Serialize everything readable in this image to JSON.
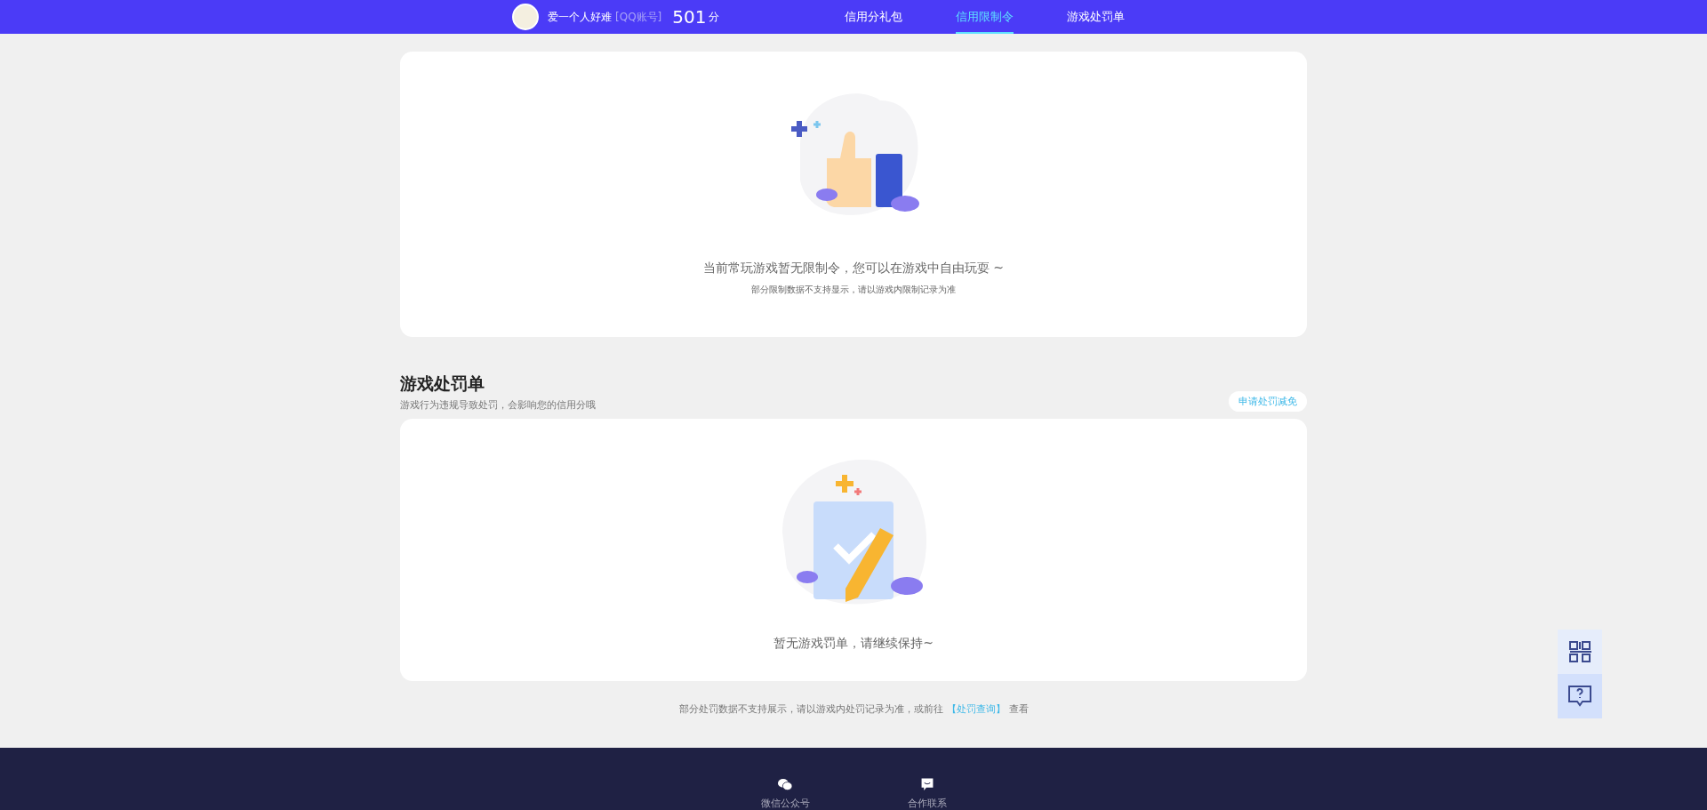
{
  "header": {
    "user": {
      "name": "爱一个人好难",
      "account_tag": "[QQ账号]",
      "score": "501",
      "score_unit": "分"
    },
    "tabs": [
      {
        "label": "信用分礼包",
        "selected": false
      },
      {
        "label": "信用限制令",
        "selected": true
      },
      {
        "label": "游戏处罚单",
        "selected": false
      }
    ]
  },
  "restriction_card": {
    "message": "当前常玩游戏暂无限制令，您可以在游戏中自由玩耍 ~",
    "note": "部分限制数据不支持显示，请以游戏内限制记录为准"
  },
  "penalty_section": {
    "title": "游戏处罚单",
    "subtitle": "游戏行为违规导致处罚，会影响您的信用分哦",
    "action": "申请处罚减免",
    "message": "暂无游戏罚单，请继续保持~"
  },
  "footnote": {
    "text": "部分处罚数据不支持展示，请以游戏内处罚记录为准，或前往",
    "link": "【处罚查询】",
    "suffix": "查看"
  },
  "footer": {
    "items": [
      {
        "kind": "wechat",
        "label": "微信公众号"
      },
      {
        "kind": "contact",
        "label": "合作联系"
      }
    ]
  },
  "float_buttons": [
    {
      "kind": "qr",
      "selected": false
    },
    {
      "kind": "help",
      "selected": true
    }
  ]
}
